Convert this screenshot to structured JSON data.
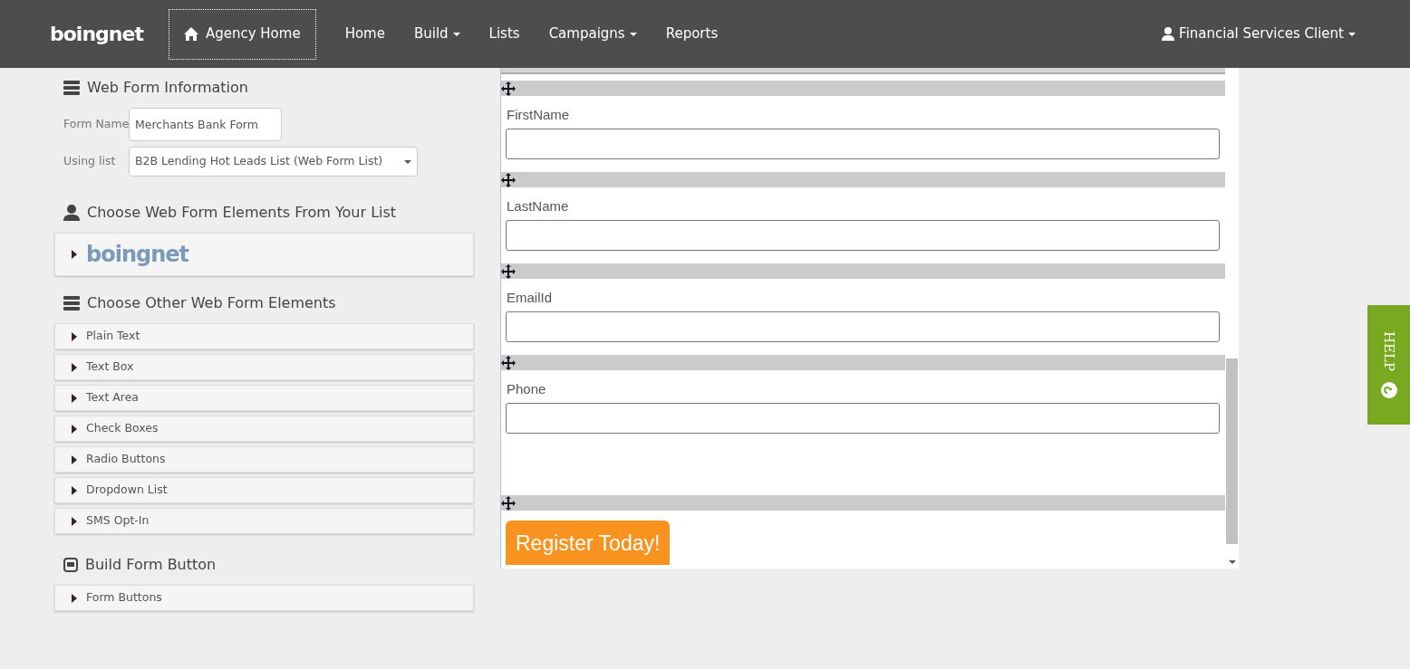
{
  "navbar": {
    "brand": "boingnet",
    "agency_home": "Agency Home",
    "items": [
      {
        "label": "Home",
        "dropdown": false
      },
      {
        "label": "Build",
        "dropdown": true
      },
      {
        "label": "Lists",
        "dropdown": false
      },
      {
        "label": "Campaigns",
        "dropdown": true
      },
      {
        "label": "Reports",
        "dropdown": false
      }
    ],
    "user": "Financial Services Client"
  },
  "web_form_info": {
    "title": "Web Form Information",
    "form_name_label": "Form Name",
    "form_name": "Merchants Bank Form",
    "using_list_label": "Using list",
    "using_list": "B2B Lending Hot Leads List (Web Form List)"
  },
  "list_elements": {
    "title": "Choose Web Form Elements From Your List",
    "brand": "boingnet"
  },
  "other_elements": {
    "title": "Choose Other Web Form Elements",
    "items": [
      "Plain Text",
      "Text Box",
      "Text Area",
      "Check Boxes",
      "Radio Buttons",
      "Dropdown List",
      "SMS Opt-In"
    ]
  },
  "form_button": {
    "title": "Build Form Button",
    "items": [
      "Form Buttons"
    ]
  },
  "preview": {
    "fields": [
      {
        "kind": "input",
        "label": "FirstName"
      },
      {
        "kind": "input",
        "label": "LastName"
      },
      {
        "kind": "input",
        "label": "EmailId"
      },
      {
        "kind": "input",
        "label": "Phone"
      },
      {
        "kind": "button",
        "label": "Register Today!"
      }
    ]
  },
  "help": {
    "label": "HELP"
  }
}
